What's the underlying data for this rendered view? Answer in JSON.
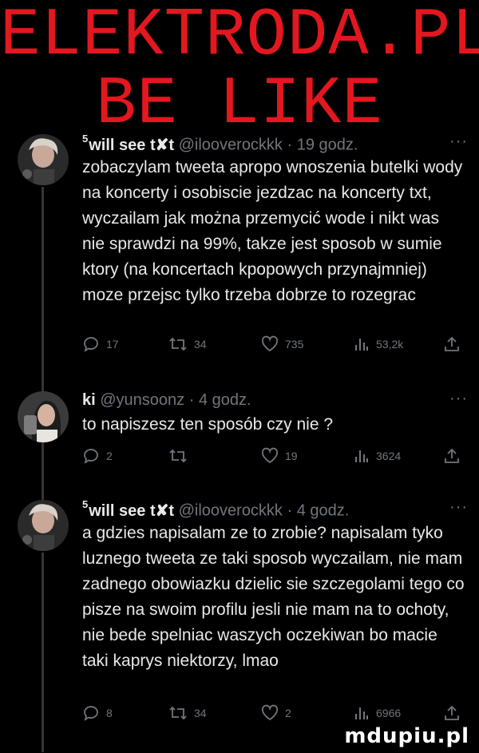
{
  "meme": {
    "line1": "ELEKTRODA.PL",
    "line2": "BE LIKE"
  },
  "tweets": [
    {
      "name": "will see t✘t",
      "name_prefix": "5",
      "handle": "@ilooverockkk",
      "time": "· 19 godz.",
      "more": "···",
      "text": "zobaczylam tweeta apropo wnoszenia butelki wody na koncerty i osobiscie jezdzac na koncerty txt, wyczailam jak można przemycić wode i nikt was nie sprawdzi na 99%, takze jest sposob w sumie ktory (na koncertach kpopowych przynajmniej) moze przejsc tylko trzeba dobrze to rozegrac",
      "replies": "17",
      "retweets": "34",
      "likes": "735",
      "views": "53,2k"
    },
    {
      "name": "ki",
      "name_prefix": "",
      "handle": "@yunsoonz",
      "time": "· 4 godz.",
      "more": "···",
      "text": "to napiszesz ten sposób czy nie ?",
      "replies": "2",
      "retweets": "",
      "likes": "19",
      "views": "3624"
    },
    {
      "name": "will see t✘t",
      "name_prefix": "5",
      "handle": "@ilooverockkk",
      "time": "· 4 godz.",
      "more": "···",
      "text": "a gdzies napisalam ze to zrobie? napisalam tyko luznego tweeta ze taki sposob wyczailam, nie mam zadnego obowiazku dzielic sie szczegolami tego co pisze na swoim profilu jesli nie mam na to ochoty, nie bede spelniac waszych oczekiwan bo macie taki kaprys niektorzy, lmao",
      "replies": "8",
      "retweets": "34",
      "likes": "2",
      "views": "6966"
    }
  ],
  "watermark": "mdupiu.pl",
  "colors": {
    "title_red": "#e3171f",
    "text": "#e7e9ea",
    "muted": "#71767b",
    "thread_line": "#333639"
  }
}
